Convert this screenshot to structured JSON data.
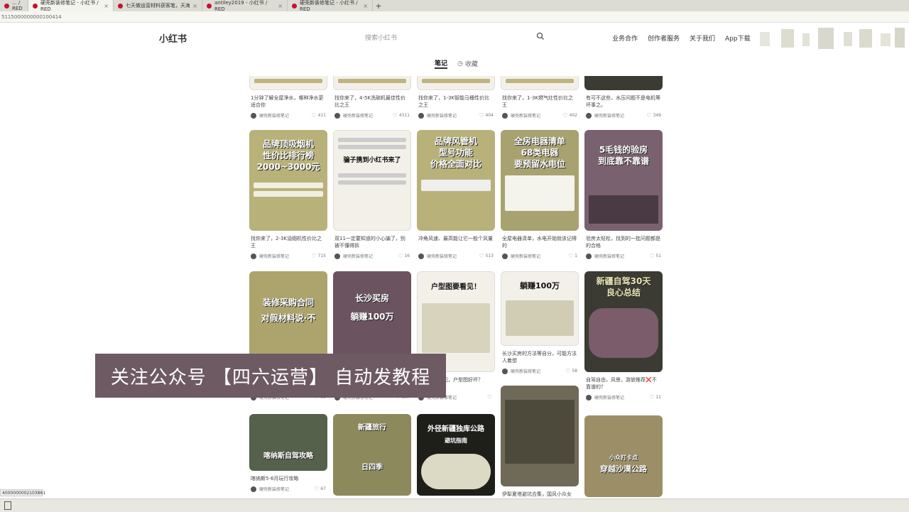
{
  "browser": {
    "tabs": [
      {
        "label": "... / RED"
      },
      {
        "label": "硬壳新装修笔记 - 小红书 / RED"
      },
      {
        "label": "七天做运营材料获客笔，天海获客"
      },
      {
        "label": "antiley2019 - 小红书 / RED"
      },
      {
        "label": "硬壳新装修笔记 - 小红书 / RED"
      }
    ],
    "new_tab": "+",
    "address": "5115000000000100414"
  },
  "header": {
    "logo": "小红书",
    "search_placeholder": "搜索小红书",
    "nav": [
      "业务合作",
      "创作者服务",
      "关于我们",
      "App下载"
    ]
  },
  "profile_tabs": {
    "notes": "笔记",
    "favorites": "收藏"
  },
  "feed": {
    "row0": [
      {
        "desc": "1分钟了解全屋净水，哪种净水更适合你",
        "author": "硬壳新装修笔记",
        "likes": "411"
      },
      {
        "desc": "找你来了，4-5K洗碗机最佳性价比之王",
        "author": "硬壳新装修笔记",
        "likes": "4311"
      },
      {
        "desc": "找你来了，1-3K智能马桶性价比之王",
        "author": "硬壳新装修笔记",
        "likes": "404"
      },
      {
        "desc": "找你来了，1-3K燃气灶性价比之王",
        "author": "硬壳新装修笔记",
        "likes": "402"
      },
      {
        "desc": "有可不这些，水压问题不是电机等坏事之。",
        "author": "硬壳新装修笔记",
        "likes": "349"
      }
    ],
    "row1": [
      {
        "title": [
          "品牌顶吸烟机",
          "性价比排行榜",
          "2000~3000元"
        ],
        "desc": "找你来了，2-3K油烟机性价比之王",
        "author": "硬壳新装修笔记",
        "likes": "715"
      },
      {
        "title": [
          "骗子携到小红书来了"
        ],
        "desc": "双11一定要知道的小心骗了，别被不懂得拆",
        "author": "硬壳新装修笔记",
        "likes": "16"
      },
      {
        "title": [
          "品牌风管机",
          "型号功能",
          "价格全面对比"
        ],
        "desc": "冲角风速、最高能让它一般个风量",
        "author": "硬壳新装修笔记",
        "likes": "513"
      },
      {
        "title": [
          "全房电器清单",
          "68类电器",
          "要预留水电位"
        ],
        "desc": "全屋电器清单，水电开始就该记得的",
        "author": "硬壳新装修笔记",
        "likes": "1"
      },
      {
        "title": [
          "5毛钱的验房",
          "到底靠不靠谱"
        ],
        "desc": "验房太轻松，找到的一批问题都是的合格",
        "author": "硬壳新装修笔记",
        "likes": "51"
      }
    ],
    "row2": [
      {
        "title": [
          "装修采购合同",
          "对假材料说·不"
        ],
        "desc": "",
        "author": "硬壳新装修笔记",
        "likes": "30"
      },
      {
        "title": [
          "长沙买房",
          "躺赚100万"
        ],
        "desc": "",
        "author": "硬壳新装修笔记",
        "likes": "107"
      },
      {
        "title": [
          "户型图要看见！"
        ],
        "desc": "户型图要看见，户型图好坏？",
        "author": "硬壳新装修笔记",
        "likes": ""
      },
      {
        "title": [
          "躺赚100万"
        ],
        "desc": "长沙买房的方法等自分，可能方法人着想",
        "author": "硬壳新装修笔记",
        "likes": "58"
      },
      {
        "title": [
          "新疆自驾30天",
          "良心总结"
        ],
        "desc": "自驾自由，风景，游旅推荐❌不靠谱的？",
        "author": "硬壳新装修笔记",
        "likes": "11"
      }
    ],
    "row3": [
      {
        "title": [
          "喀纳斯自驾攻略"
        ],
        "desc": "喀纳斯5-6月玩行攻略",
        "author": "硬壳新装修笔记",
        "likes": "67"
      },
      {
        "title": [
          "新疆旅行",
          "日四季"
        ],
        "desc": "",
        "author": "",
        "likes": ""
      },
      {
        "title": [
          "外径新疆独库公路",
          "避坑指南"
        ],
        "desc": "",
        "author": "",
        "likes": ""
      },
      {
        "title": [],
        "desc": "伊犁夏塔避坑合集，国风小众女",
        "author": "",
        "likes": ""
      },
      {
        "title": [
          "小众打卡点",
          "穿越沙漠公路"
        ],
        "desc": "",
        "author": "",
        "likes": ""
      }
    ]
  },
  "banner": "关注公众号 【四六运营】 自动发教程",
  "status_text": "4000000002103861"
}
